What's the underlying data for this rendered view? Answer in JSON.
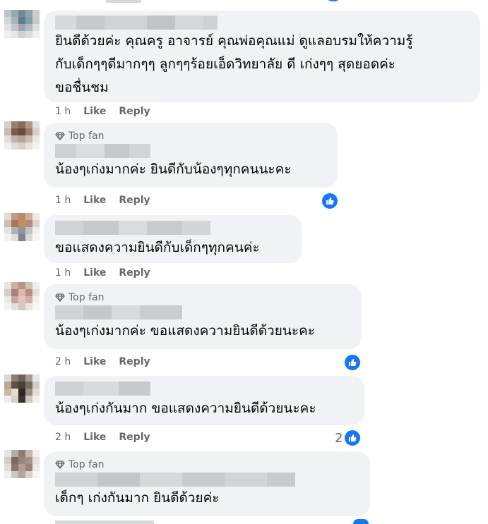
{
  "comments": [
    {
      "top_fan": "",
      "text": "ยินดีด้วยค่ะ คุณครู อาจารย์ คุณพ่อคุณแม่ ดูแลอบรมให้ความรู้\nกับเด็กๆๆดีมากๆๆ ลูกๆๆร้อยเอ็ดวิทยาลัย ดี เก่งๆๆ สุดยอดค่ะ\nขอชื่นชม",
      "time": "1 h",
      "like": "Like",
      "reply": "Reply",
      "reaction_count": ""
    },
    {
      "top_fan": "Top fan",
      "text": "น้องๆเก่งมากค่ะ ยินดีกับน้องๆทุกคนนะคะ",
      "time": "1 h",
      "like": "Like",
      "reply": "Reply",
      "reaction_count": ""
    },
    {
      "top_fan": "",
      "text": "ขอแสดงความยินดีกับเด็กๆทุกคนค่ะ",
      "time": "1 h",
      "like": "Like",
      "reply": "Reply",
      "reaction_count": ""
    },
    {
      "top_fan": "Top fan",
      "text": "น้องๆเก่งมากค่ะ ขอแสดงความยินดีด้วยนะคะ",
      "time": "2 h",
      "like": "Like",
      "reply": "Reply",
      "reaction_count": ""
    },
    {
      "top_fan": "",
      "text": "น้องๆเก่งกันมาก ขอแสดงความยินดีด้วยนะคะ",
      "time": "2 h",
      "like": "Like",
      "reply": "Reply",
      "reaction_count": "2"
    },
    {
      "top_fan": "Top fan",
      "text": "เด็กๆ เก่งกันมาก ยินดีด้วยค่ะ",
      "time": "",
      "like": "",
      "reply": "",
      "reaction_count": ""
    }
  ],
  "colors": {
    "bubble": "#f0f2f5",
    "meta_text": "#65676b",
    "like_blue": "#1877f2"
  },
  "icons": {
    "top_fan": "diamond-icon",
    "reaction": "thumbs-up-icon"
  }
}
